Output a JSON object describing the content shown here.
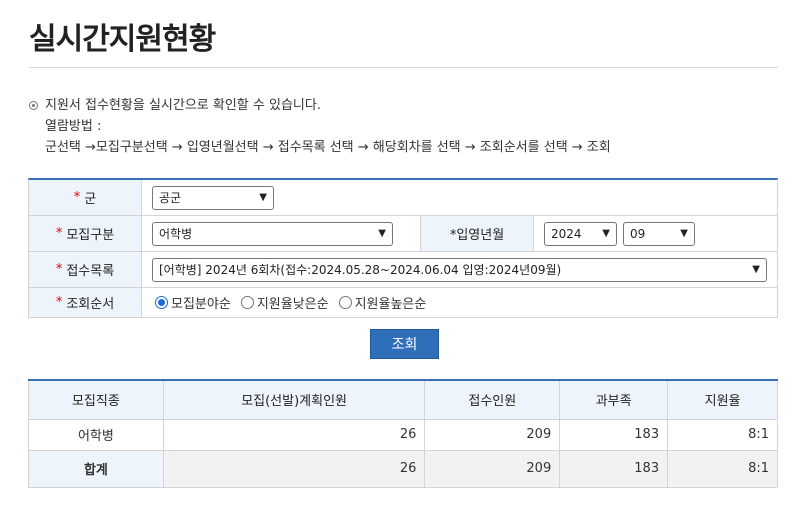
{
  "page": {
    "title": "실시간지원현황"
  },
  "info": {
    "line1": "지원서 접수현황을 실시간으로 확인할 수 있습니다.",
    "line2": "열람방법 :",
    "line3": "군선택 →모집구분선택 → 입영년월선택 → 접수목록 선택 → 해당회차를 선택 → 조회순서를 선택 → 조회"
  },
  "form": {
    "required_mark": "*",
    "military": {
      "label": "군",
      "value": "공군"
    },
    "category": {
      "label": "모집구분",
      "value": "어학병"
    },
    "enlist": {
      "label": "*입영년월",
      "year": "2024",
      "month": "09"
    },
    "intake": {
      "label": "접수목록",
      "value": "[어학병] 2024년 6회차(접수:2024.05.28~2024.06.04 입영:2024년09월)"
    },
    "order": {
      "label": "조회순서",
      "options": [
        "모집분야순",
        "지원율낮은순",
        "지원율높은순"
      ],
      "selected": 0
    }
  },
  "search_button": "조회",
  "table": {
    "headers": [
      "모집직종",
      "모집(선발)계획인원",
      "접수인원",
      "과부족",
      "지원율"
    ],
    "rows": [
      [
        "어학병",
        "26",
        "209",
        "183",
        "8:1"
      ]
    ],
    "total": [
      "합계",
      "26",
      "209",
      "183",
      "8:1"
    ]
  }
}
